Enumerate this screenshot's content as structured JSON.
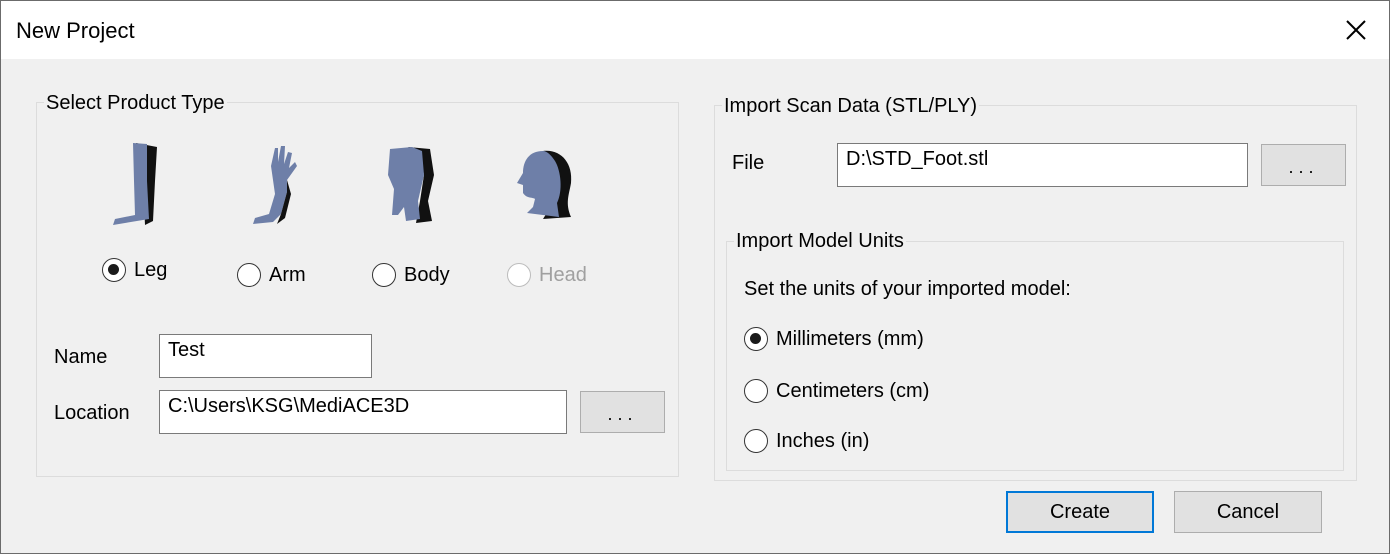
{
  "window": {
    "title": "New Project",
    "close_icon": "close-icon"
  },
  "product_type": {
    "group_label": "Select Product Type",
    "options": [
      {
        "label": "Leg",
        "checked": true,
        "enabled": true,
        "icon": "leg-icon"
      },
      {
        "label": "Arm",
        "checked": false,
        "enabled": true,
        "icon": "arm-icon"
      },
      {
        "label": "Body",
        "checked": false,
        "enabled": true,
        "icon": "torso-icon"
      },
      {
        "label": "Head",
        "checked": false,
        "enabled": false,
        "icon": "head-icon"
      }
    ],
    "name_label": "Name",
    "name_value": "Test",
    "location_label": "Location",
    "location_value": "C:\\Users\\KSG\\MediACE3D",
    "browse_label": "..."
  },
  "import_scan": {
    "group_label": "Import Scan Data (STL/PLY)",
    "file_label": "File",
    "file_value": "D:\\STD_Foot.stl",
    "browse_label": "..."
  },
  "import_units": {
    "group_label": "Import Model Units",
    "instruction": "Set the units of your imported model:",
    "options": [
      {
        "label": "Millimeters (mm)",
        "checked": true
      },
      {
        "label": "Centimeters (cm)",
        "checked": false
      },
      {
        "label": "Inches (in)",
        "checked": false
      }
    ]
  },
  "actions": {
    "create_label": "Create",
    "cancel_label": "Cancel"
  },
  "colors": {
    "accent": "#0078d7",
    "model": "#6e7fa8",
    "model_shadow": "#111111"
  }
}
